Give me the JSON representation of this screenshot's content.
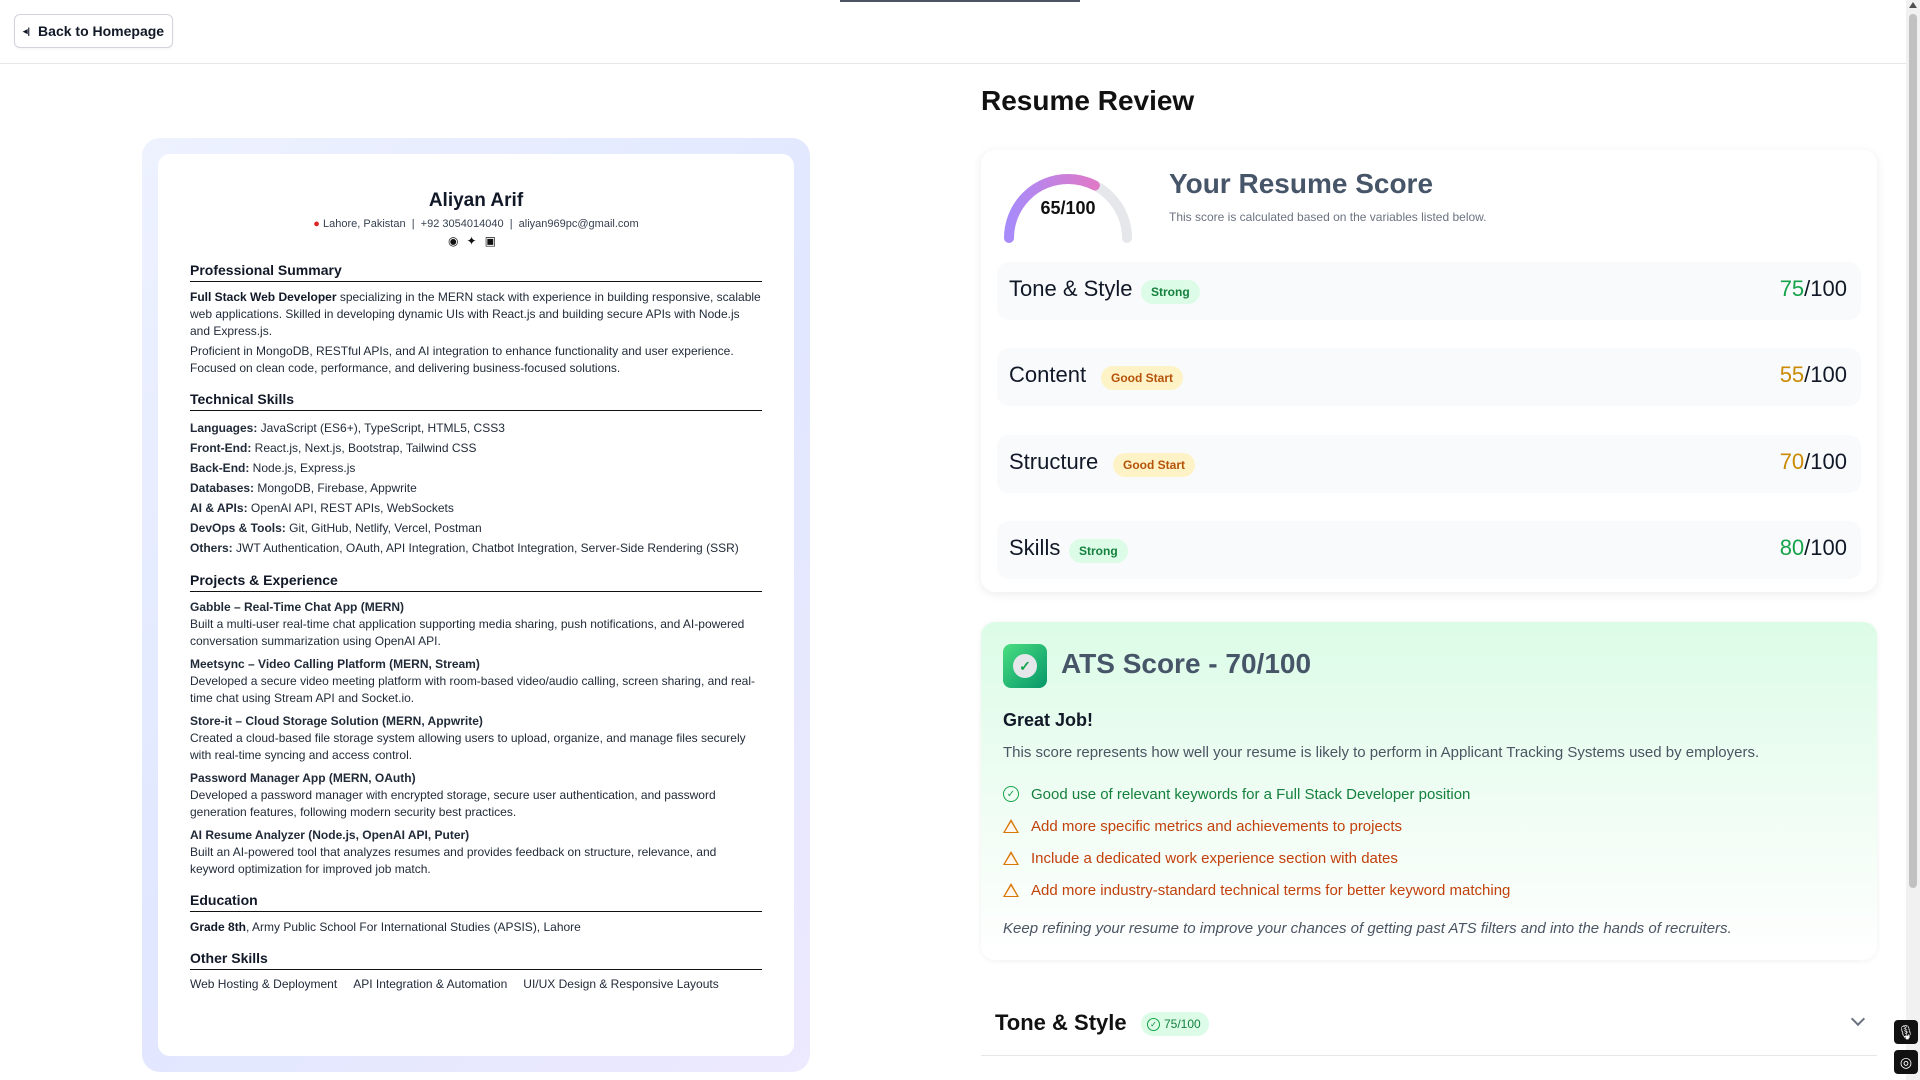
{
  "header": {
    "back_label": "Back to Homepage",
    "back_icon": "arrow-left-icon"
  },
  "resume": {
    "name": "Aliyan Arif",
    "location": "Lahore, Pakistan",
    "phone": "+92 3054014040",
    "email": "aliyan969pc@gmail.com",
    "social_icons": [
      "github-icon",
      "twitter-icon",
      "linkedin-icon"
    ],
    "sections": {
      "summary_title": "Professional Summary",
      "summary_lead": "Full Stack Web Developer",
      "summary_p1": " specializing in the MERN stack with experience in building responsive, scalable web applications. Skilled in developing dynamic UIs with React.js and building secure APIs with Node.js and Express.js.",
      "summary_p2": "Proficient in MongoDB, RESTful APIs, and AI integration to enhance functionality and user experience. Focused on clean code, performance, and delivering business-focused solutions.",
      "skills_title": "Technical Skills",
      "skills": [
        {
          "k": "Languages:",
          "v": " JavaScript (ES6+), TypeScript, HTML5, CSS3"
        },
        {
          "k": "Front-End:",
          "v": " React.js, Next.js, Bootstrap, Tailwind CSS"
        },
        {
          "k": "Back-End:",
          "v": " Node.js, Express.js"
        },
        {
          "k": "Databases:",
          "v": " MongoDB, Firebase, Appwrite"
        },
        {
          "k": "AI & APIs:",
          "v": " OpenAI API, REST APIs, WebSockets"
        },
        {
          "k": "DevOps & Tools:",
          "v": " Git, GitHub, Netlify, Vercel, Postman"
        },
        {
          "k": "Others:",
          "v": " JWT Authentication, OAuth, API Integration, Chatbot Integration, Server-Side Rendering (SSR)"
        }
      ],
      "projects_title": "Projects & Experience",
      "projects": [
        {
          "t": "Gabble – Real-Time Chat App (MERN)",
          "d": "Built a multi-user real-time chat application supporting media sharing, push notifications, and AI-powered conversation summarization using OpenAI API."
        },
        {
          "t": "Meetsync – Video Calling Platform (MERN, Stream)",
          "d": "Developed a secure video meeting platform with room-based video/audio calling, screen sharing, and real-time chat using Stream API and Socket.io."
        },
        {
          "t": "Store-it – Cloud Storage Solution (MERN, Appwrite)",
          "d": "Created a cloud-based file storage system allowing users to upload, organize, and manage files securely with real-time syncing and access control."
        },
        {
          "t": "Password Manager App (MERN, OAuth)",
          "d": "Developed a password manager with encrypted storage, secure user authentication, and password generation features, following modern security best practices."
        },
        {
          "t": "AI Resume Analyzer (Node.js, OpenAI API, Puter)",
          "d": "Built an AI-powered tool that analyzes resumes and provides feedback on structure, relevance, and keyword optimization for improved job match."
        }
      ],
      "education_title": "Education",
      "education_lead": "Grade 8th",
      "education_rest": ", Army Public School For International Studies (APSIS), Lahore",
      "other_title": "Other Skills",
      "other": [
        "Web Hosting & Deployment",
        "API Integration & Automation",
        "UI/UX Design & Responsive Layouts"
      ]
    }
  },
  "review": {
    "title": "Resume Review",
    "score_text": "65/100",
    "score_value": 65,
    "score_title": "Your Resume Score",
    "score_sub": "This score is calculated based on the variables listed below.",
    "categories": [
      {
        "name": "Tone & Style",
        "badge": "Strong",
        "score": "75",
        "total": "/100"
      },
      {
        "name": "Content",
        "badge": "Good Start",
        "score": "55",
        "total": "/100"
      },
      {
        "name": "Structure",
        "badge": "Good Start",
        "score": "70",
        "total": "/100"
      },
      {
        "name": "Skills",
        "badge": "Strong",
        "score": "80",
        "total": "/100"
      }
    ]
  },
  "ats": {
    "title": "ATS Score - 70/100",
    "great": "Great Job!",
    "desc": "This score represents how well your resume is likely to perform in Applicant Tracking Systems used by employers.",
    "items": [
      "Good use of relevant keywords for a Full Stack Developer position",
      "Add more specific metrics and achievements to projects",
      "Include a dedicated work experience section with dates",
      "Add more industry-standard technical terms for better keyword matching"
    ],
    "foot": "Keep refining your resume to improve your chances of getting past ATS filters and into the hands of recruiters."
  },
  "accordion": {
    "title": "Tone & Style",
    "badge": "75/100"
  },
  "colors": {
    "strong": "#16a34a",
    "good": "#ca8a04",
    "gauge_start": "#a78bfa",
    "gauge_end": "#f472b6"
  }
}
